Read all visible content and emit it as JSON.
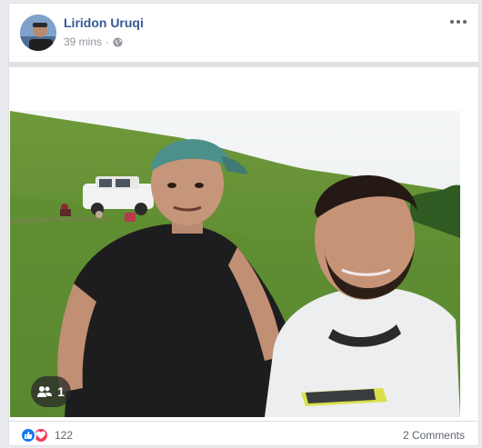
{
  "post": {
    "author": "Liridon Uruqi",
    "time": "39 mins",
    "privacy_icon": "globe-icon",
    "more_icon": "ellipsis-icon"
  },
  "photo": {
    "tag_count": "1",
    "tag_icon": "people-icon"
  },
  "footer": {
    "reaction_icons": [
      "like-icon",
      "love-icon"
    ],
    "reaction_count": "122",
    "comments_label": "2 Comments"
  },
  "colors": {
    "author_link": "#365899",
    "like_blue": "#1877f2",
    "love_red": "#f33e58",
    "meta_gray": "#90949c"
  }
}
